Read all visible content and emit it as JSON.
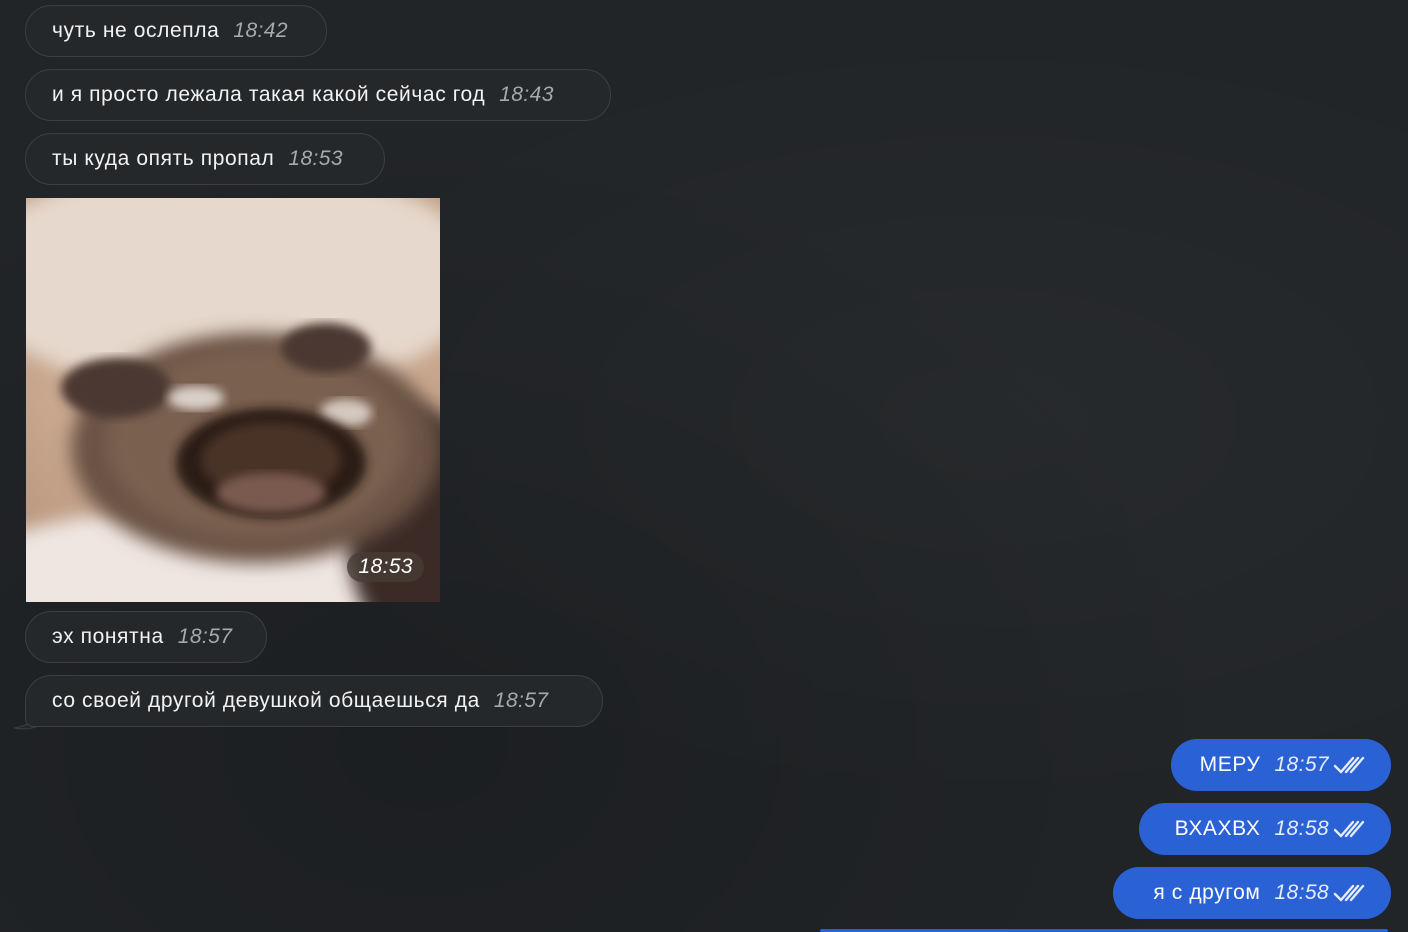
{
  "incoming": [
    {
      "text": "чуть не ослепла",
      "time": "18:42"
    },
    {
      "text": "и я просто лежала такая какой сейчас год",
      "time": "18:43"
    },
    {
      "text": "ты куда опять пропал",
      "time": "18:53"
    },
    {
      "text": "эх понятна",
      "time": "18:57"
    },
    {
      "text": "со своей другой девушкой общаешься да",
      "time": "18:57"
    }
  ],
  "photo": {
    "time": "18:53",
    "icon": "crying-cat-photo"
  },
  "outgoing": [
    {
      "text": "МЕРУ",
      "time": "18:57",
      "status_icon": "double-check-icon"
    },
    {
      "text": "ВХАХВХ",
      "time": "18:58",
      "status_icon": "double-check-icon"
    },
    {
      "text": "я с другом",
      "time": "18:58",
      "status_icon": "double-check-icon"
    }
  ],
  "colors": {
    "background": "#222528",
    "incoming_bubble": "#25282b",
    "incoming_border": "#3b3f43",
    "outgoing_bubble": "#2a62d6"
  }
}
